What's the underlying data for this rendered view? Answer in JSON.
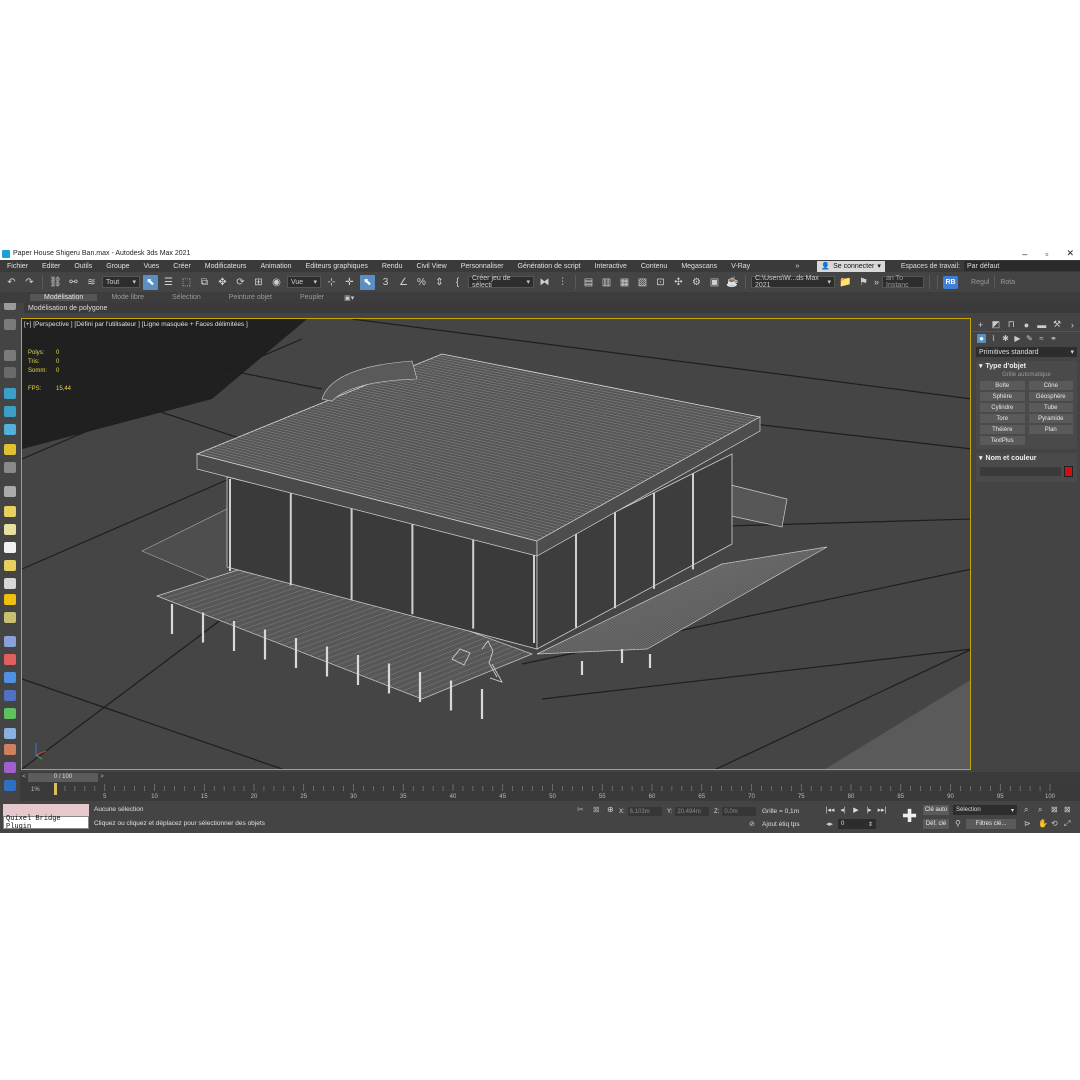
{
  "window": {
    "title": "Paper House Shigeru Ban.max - Autodesk 3ds Max 2021",
    "minimize": "–",
    "restore": "▫",
    "close": "✕"
  },
  "menu": {
    "items": [
      "Fichier",
      "Editer",
      "Outils",
      "Groupe",
      "Vues",
      "Créer",
      "Modificateurs",
      "Animation",
      "Editeurs graphiques",
      "Rendu",
      "Civil View",
      "Personnaliser",
      "Génération de script",
      "Interactive",
      "Contenu",
      "Megascans",
      "V-Ray"
    ],
    "overflow": "»",
    "sign_in": "Se connecter",
    "workspace_label": "Espaces de travail:",
    "workspace_value": "Par défaut"
  },
  "toolbar": {
    "filter_select": "Tout",
    "view_select": "Vue",
    "selection_set": "Créer jeu de sélecti",
    "project_path": "C:\\Users\\W...ds Max 2021",
    "instance_text": "an To Instanc",
    "user_badge": "RB",
    "regul": "Regul",
    "rotate": "Rota"
  },
  "ribbon": {
    "tabs": [
      "Modélisation",
      "Mode libre",
      "Sélection",
      "Peinture objet",
      "Peupler"
    ],
    "active_tab": "Modélisation",
    "subpanel": "Modélisation de polygone"
  },
  "viewport": {
    "label": "[+] [Perspective ] [Défini par l'utilisateur ] [Ligne masquée + Faces délimitées ]",
    "stats": [
      {
        "label": "Polys:",
        "value": "0"
      },
      {
        "label": "Tris:",
        "value": "0"
      },
      {
        "label": "Somm:",
        "value": "0"
      }
    ],
    "fps_label": "FPS:",
    "fps_value": "15,44"
  },
  "command_panel": {
    "dropdown": "Primitives standard",
    "rollout_type": "Type d'objet",
    "autogrid": "Grille automatique",
    "objects": [
      "Boîte",
      "Cône",
      "Sphère",
      "Géosphère",
      "Cylindre",
      "Tube",
      "Tore",
      "Pyramide",
      "Théière",
      "Plan",
      "TextPlus"
    ],
    "rollout_name": "Nom et couleur",
    "object_color": "#d01010"
  },
  "timeline": {
    "frame_display": "0 / 100",
    "ticks": [
      "0",
      "5",
      "10",
      "15",
      "20",
      "25",
      "30",
      "35",
      "40",
      "45",
      "50",
      "55",
      "60",
      "65",
      "70",
      "75",
      "80",
      "85",
      "90",
      "95",
      "100"
    ],
    "zoom_label": "1%"
  },
  "status": {
    "maxscript_input": "Quixel Bridge Plugin",
    "selection_text": "Aucune sélection",
    "prompt_text": "Cliquez ou cliquez et déplacez pour sélectionner des objets",
    "x_label": "X:",
    "x_value": "6,103m",
    "y_label": "Y:",
    "y_value": "20,494m",
    "z_label": "Z:",
    "z_value": "0,0m",
    "grid": "Grille = 0,1m",
    "add_time_tag": "Ajout étiq tps",
    "auto_key": "Clé auto",
    "set_key": "Déf. clé",
    "key_selection": "Sélection",
    "key_filters": "Filtres clé...",
    "current_frame": "0"
  },
  "colors": {
    "accent_blue": "#5b8fc2",
    "viewport_border": "#c7a600",
    "stats_yellow": "#e8d94b"
  }
}
